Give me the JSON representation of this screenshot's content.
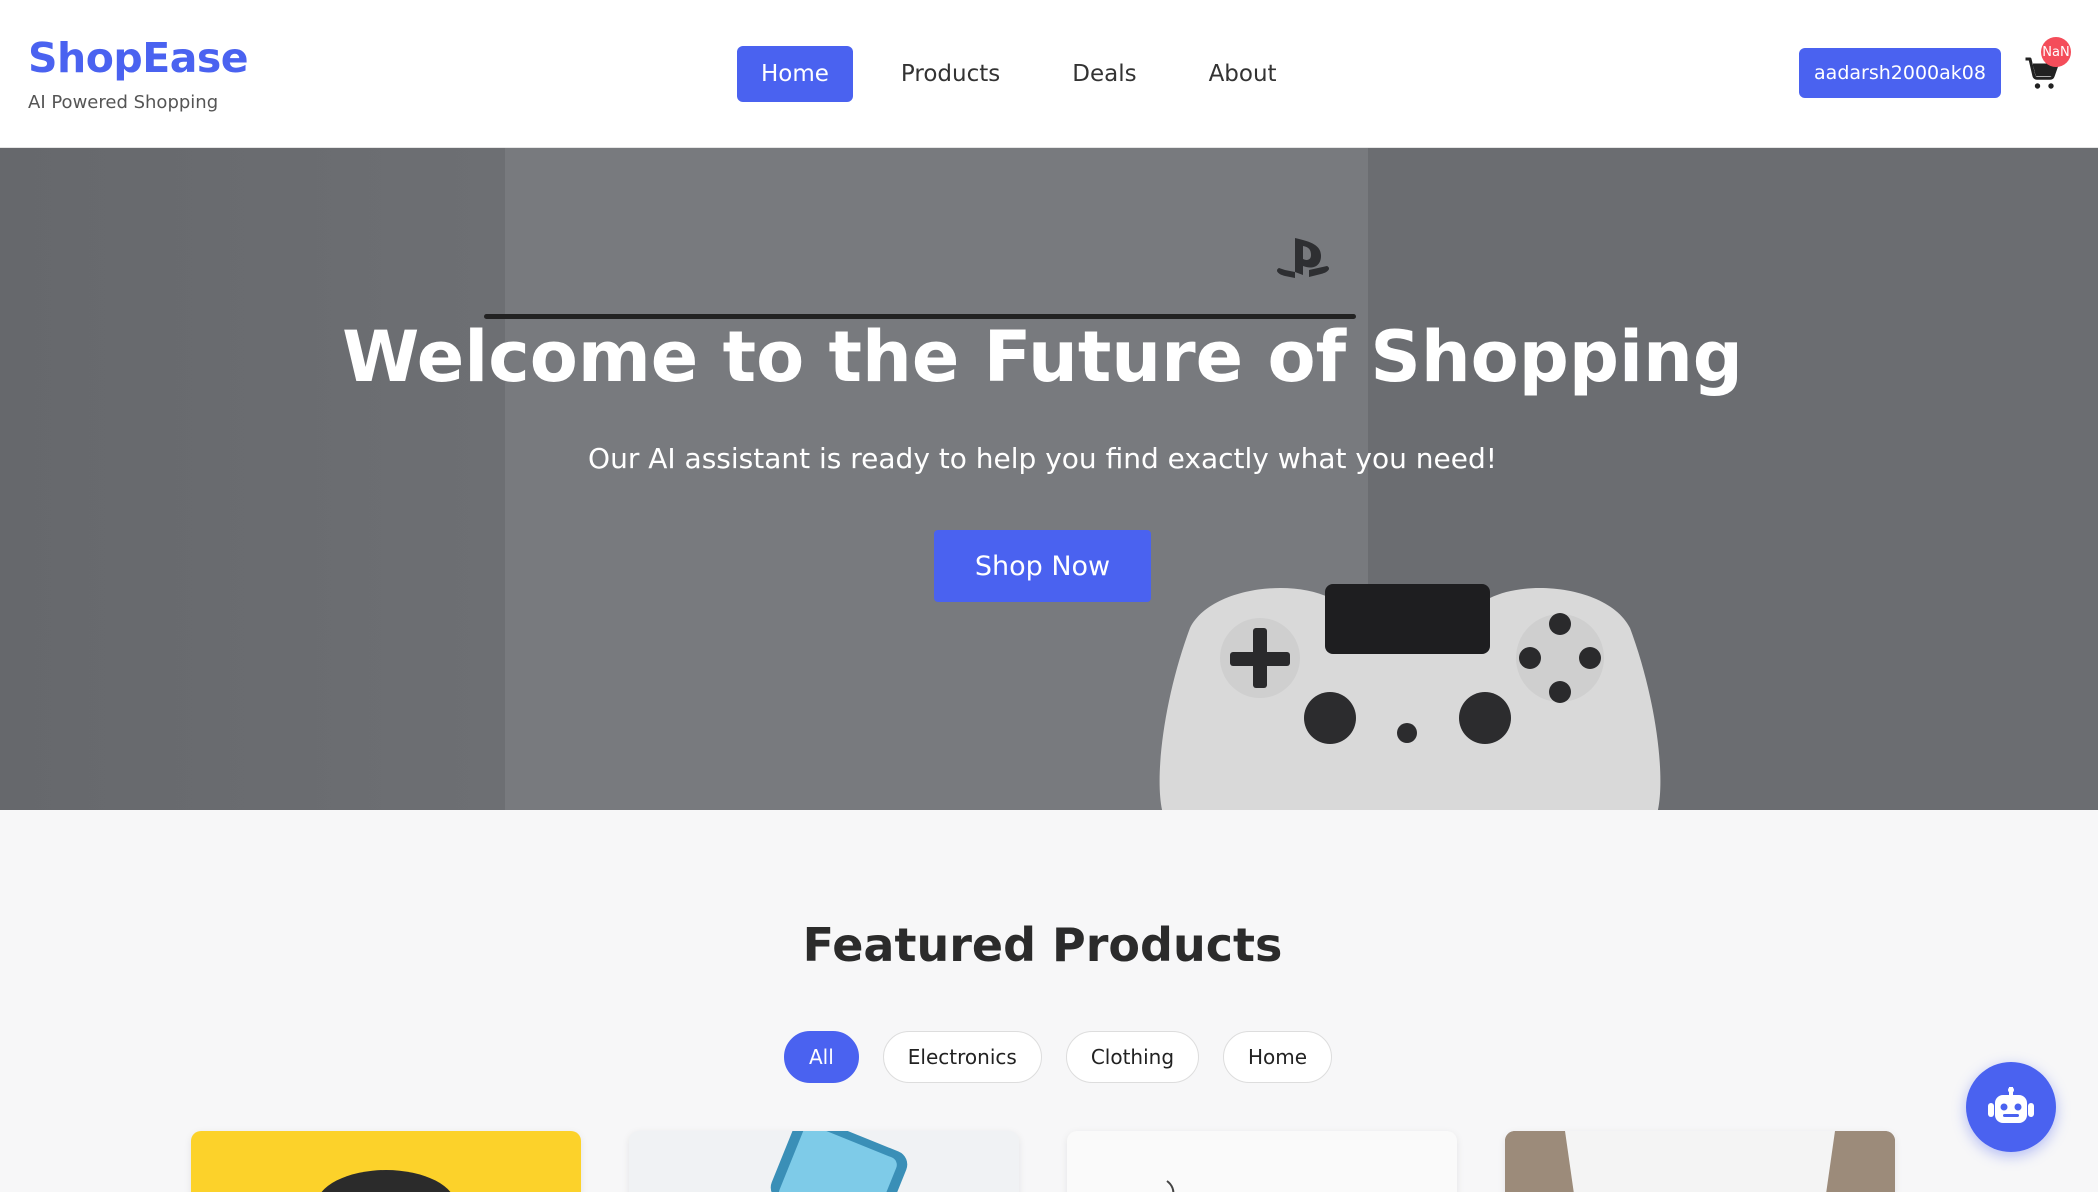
{
  "brand": {
    "name": "ShopEase",
    "tagline": "AI Powered Shopping"
  },
  "nav": {
    "items": [
      {
        "label": "Home",
        "active": true
      },
      {
        "label": "Products",
        "active": false
      },
      {
        "label": "Deals",
        "active": false
      },
      {
        "label": "About",
        "active": false
      }
    ]
  },
  "user": {
    "username": "aadarsh2000ak08"
  },
  "cart": {
    "badge": "NaN",
    "icon": "cart-icon"
  },
  "hero": {
    "title": "Welcome to the Future of Shopping",
    "subtitle": "Our AI assistant is ready to help you find exactly what you need!",
    "cta": "Shop Now"
  },
  "featured": {
    "title": "Featured Products",
    "filters": [
      {
        "label": "All",
        "active": true
      },
      {
        "label": "Electronics",
        "active": false
      },
      {
        "label": "Clothing",
        "active": false
      },
      {
        "label": "Home",
        "active": false
      }
    ]
  },
  "assistant": {
    "icon": "robot-icon"
  },
  "colors": {
    "accent": "#4a62f0",
    "badge": "#f44d5a"
  }
}
